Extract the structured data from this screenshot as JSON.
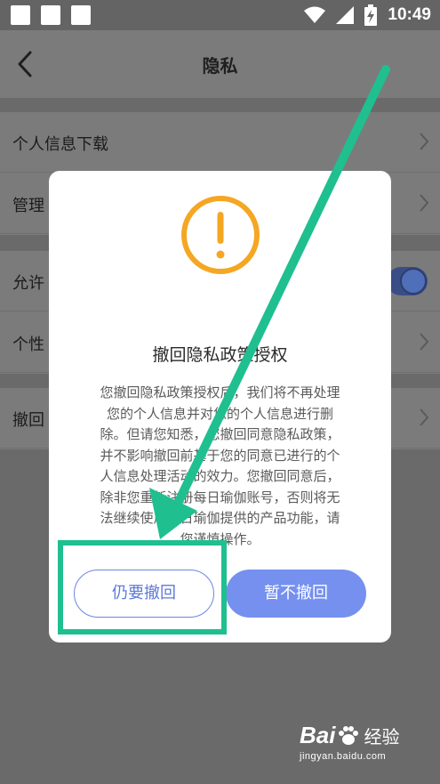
{
  "status_bar": {
    "time": "10:49",
    "icons": [
      "notification-square-icon",
      "notification-square-icon",
      "notification-square-icon",
      "wifi-icon",
      "signal-icon",
      "battery-charging-icon"
    ]
  },
  "header": {
    "title": "隐私",
    "back_icon": "chevron-left-icon"
  },
  "list": {
    "groups": [
      {
        "items": [
          {
            "label": "个人信息下载"
          },
          {
            "label": "管理"
          }
        ]
      },
      {
        "items": [
          {
            "label": "允许",
            "toggle_on": true
          },
          {
            "label": "个性"
          }
        ]
      },
      {
        "items": [
          {
            "label": "撤回"
          }
        ]
      }
    ]
  },
  "dialog": {
    "icon": "warning-icon",
    "title": "撤回隐私政策授权",
    "body_lines": [
      "您撤回隐私政策授权后，我们将不再处理",
      "您的个人信息并对您的个人信息进行删",
      "除。但请您知悉，您撤回同意隐私政策，",
      "并不影响撤回前基于您的同意已进行的个",
      "人信息处理活动的效力。您撤回同意后，",
      "除非您重新注册每日瑜伽账号，否则将无",
      "法继续使用每日瑜伽提供的产品功能，请",
      "您谨慎操作。"
    ],
    "confirm_label": "仍要撤回",
    "cancel_label": "暂不撤回"
  },
  "watermark": {
    "brand": "Bai",
    "brand2": "经验",
    "url": "jingyan.baidu.com"
  },
  "colors": {
    "accent": "#7590ef",
    "accent_outline": "#6d86e0",
    "warning": "#f5a623",
    "annotation": "#1fbf90"
  }
}
